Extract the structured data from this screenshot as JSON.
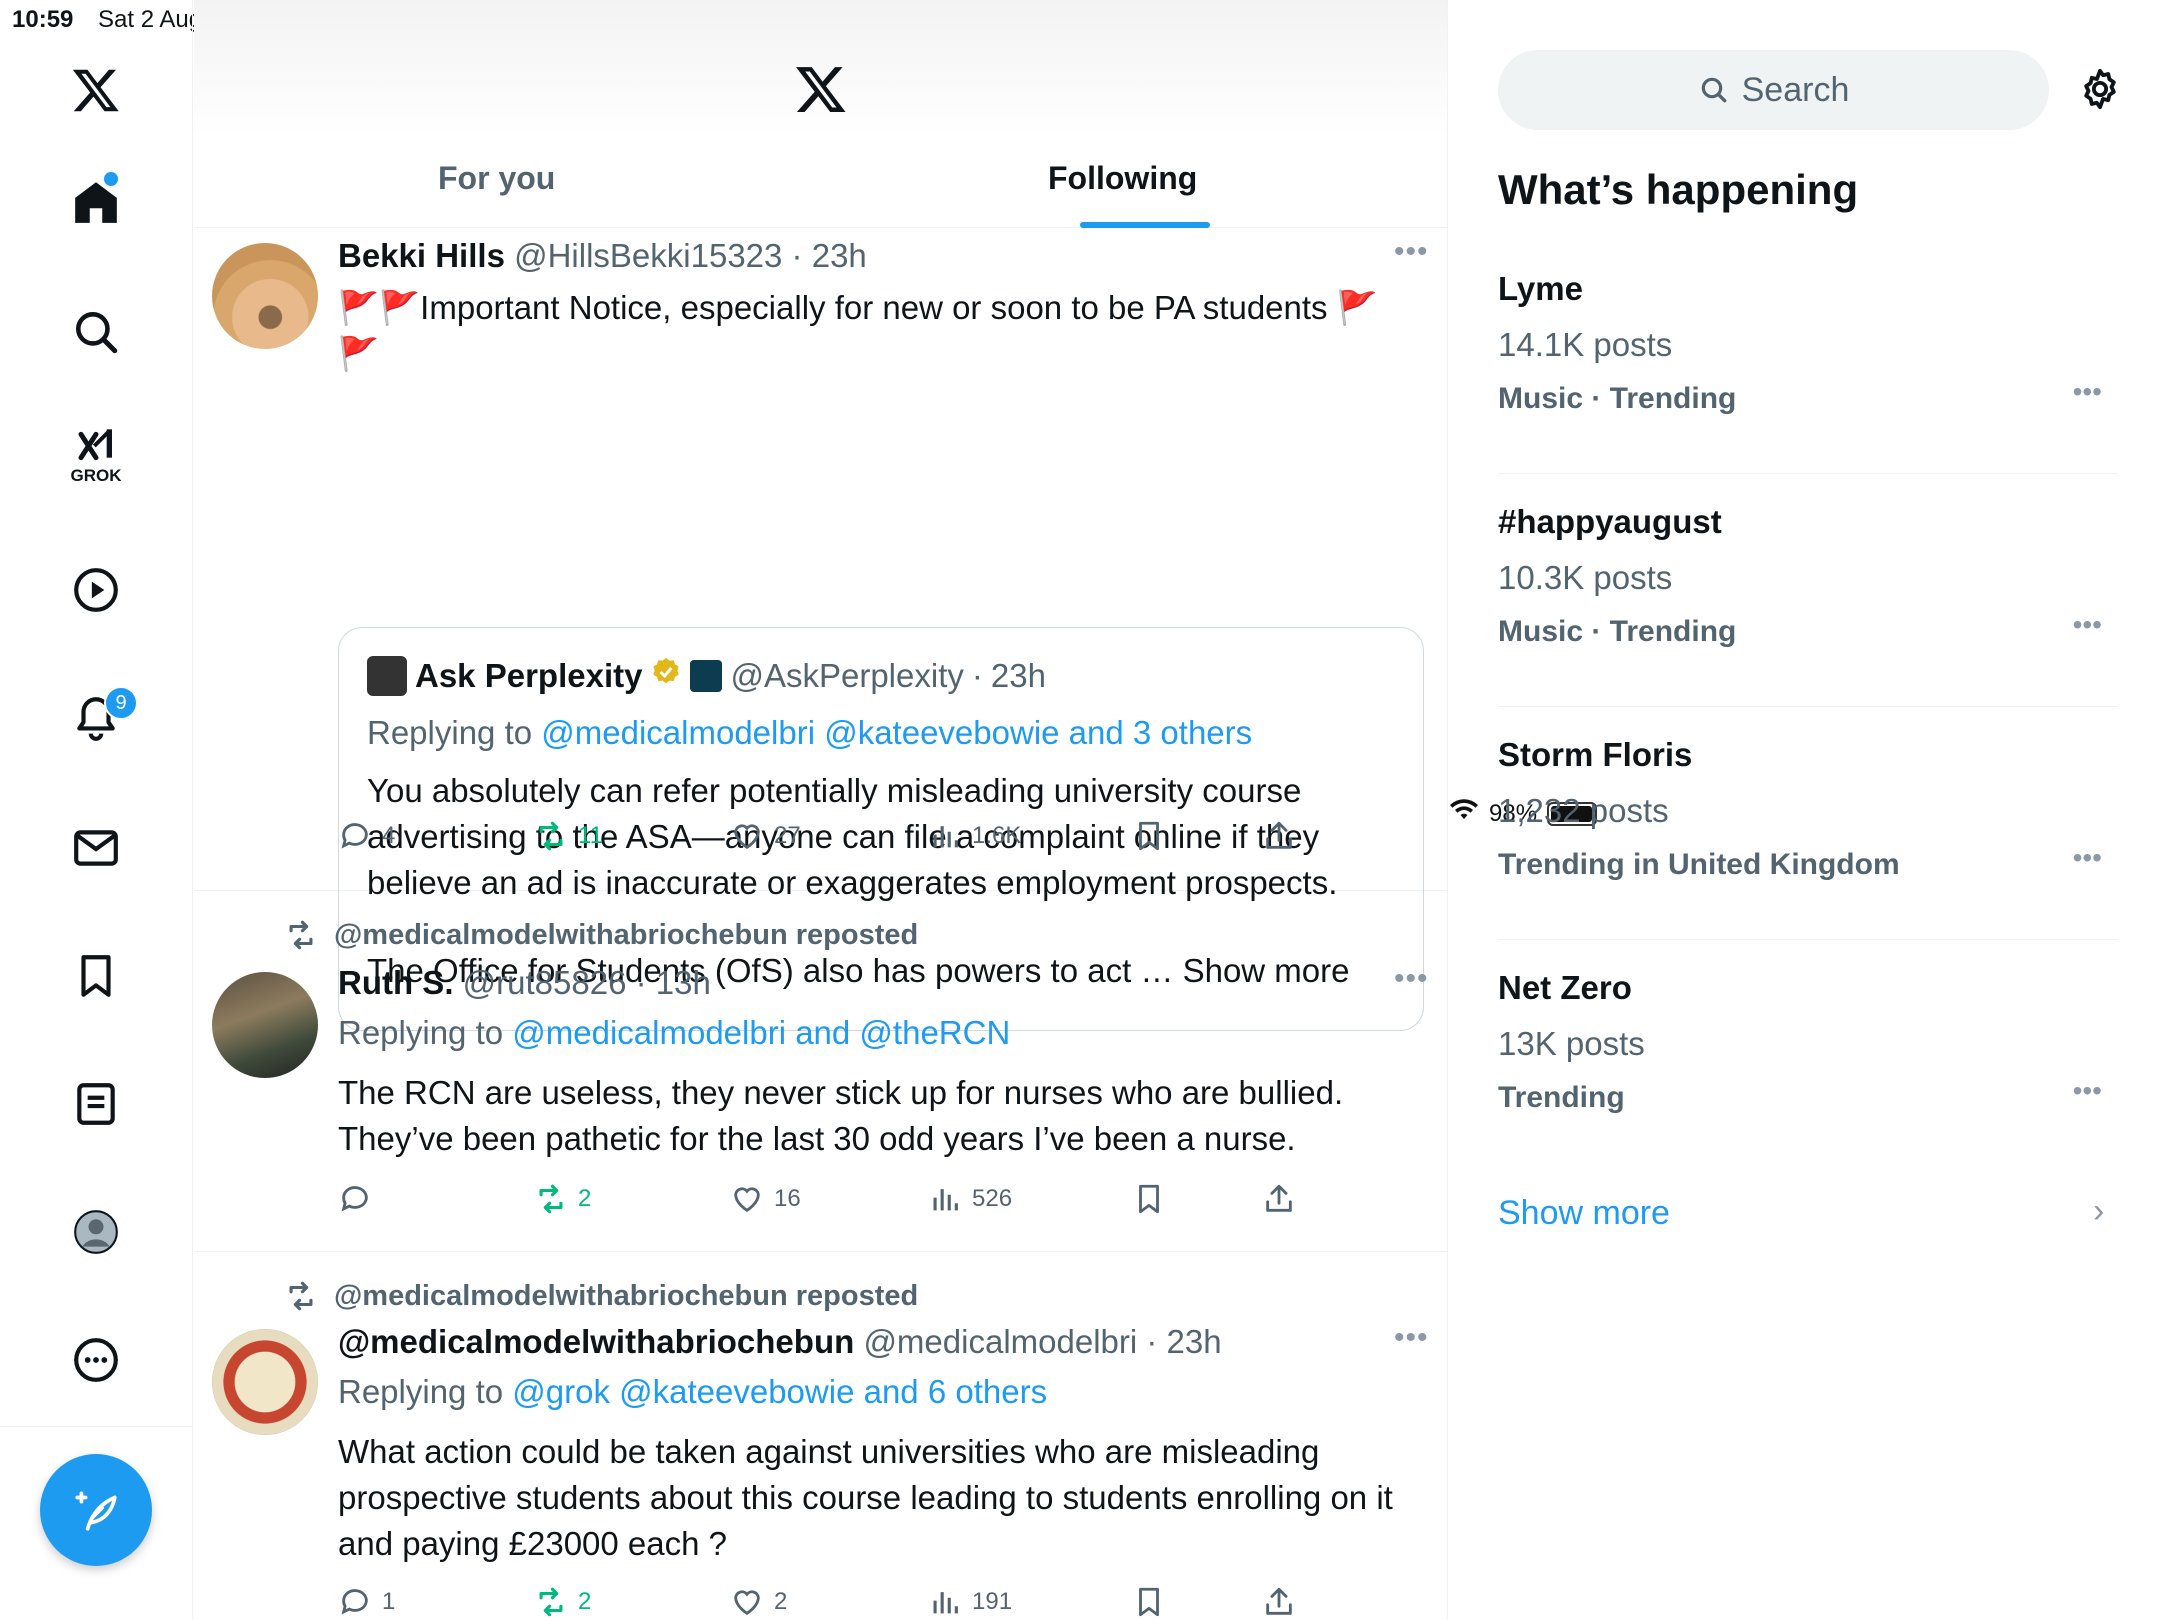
{
  "status": {
    "time": "10:59",
    "date": "Sat 2 Aug",
    "battery": "98%"
  },
  "nav": {
    "grok_label": "GROK",
    "notifications_count": "9"
  },
  "tabs": {
    "for_you": "For you",
    "following": "Following"
  },
  "posts": [
    {
      "name": "Bekki Hills",
      "handle": "@HillsBekki15323",
      "time": "23h",
      "text": "🚩🚩Important Notice, especially for new or soon to be PA students 🚩🚩",
      "quote": {
        "name": "Ask Perplexity",
        "handle": "@AskPerplexity",
        "time": "23h",
        "replying_prefix": "Replying to ",
        "replying_links": "@medicalmodelbri @kateevebowie and 3 others",
        "text1": "You absolutely can refer potentially misleading university course advertising to the ASA—anyone can file a complaint online if they believe an ad is inaccurate or exaggerates employment prospects.",
        "text2": "The Office for Students (OfS) also has powers to act … Show more"
      },
      "replies": "4",
      "reposts": "11",
      "likes": "27",
      "views": "1.6K"
    },
    {
      "repost_by": "@medicalmodelwithabriochebun reposted",
      "name": "Ruth S.",
      "handle": "@rut85826",
      "time": "13h",
      "replying_prefix": "Replying to ",
      "replying_links": "@medicalmodelbri and @theRCN",
      "text": "The RCN are useless, they never stick up for nurses who are bullied. They’ve been pathetic for the last 30 odd years I’ve been a nurse.",
      "replies": "",
      "reposts": "2",
      "likes": "16",
      "views": "526"
    },
    {
      "repost_by": "@medicalmodelwithabriochebun reposted",
      "name": "@medicalmodelwithabriochebun",
      "handle": "@medicalmodelbri",
      "time": "23h",
      "replying_prefix": "Replying to ",
      "replying_links": "@grok @kateevebowie and 6 others",
      "text": "What action could be taken against universities who are misleading prospective students about this course leading to students enrolling on it and paying £23000 each ?",
      "replies": "1",
      "reposts": "2",
      "likes": "2",
      "views": "191"
    }
  ],
  "sidebar": {
    "search_placeholder": "Search",
    "title": "What’s happening",
    "trends": [
      {
        "name": "Lyme",
        "count": "14.1K posts",
        "category": "Music · Trending"
      },
      {
        "name": "#happyaugust",
        "count": "10.3K posts",
        "category": "Music · Trending"
      },
      {
        "name": "Storm Floris",
        "count": "1,232 posts",
        "category": "Trending in United Kingdom"
      },
      {
        "name": "Net Zero",
        "count": "13K posts",
        "category": "Trending"
      }
    ],
    "show_more": "Show more"
  },
  "colors": {
    "accent": "#1d9bf0",
    "repost_green": "#00ba7c",
    "secondary_text": "#536471"
  }
}
